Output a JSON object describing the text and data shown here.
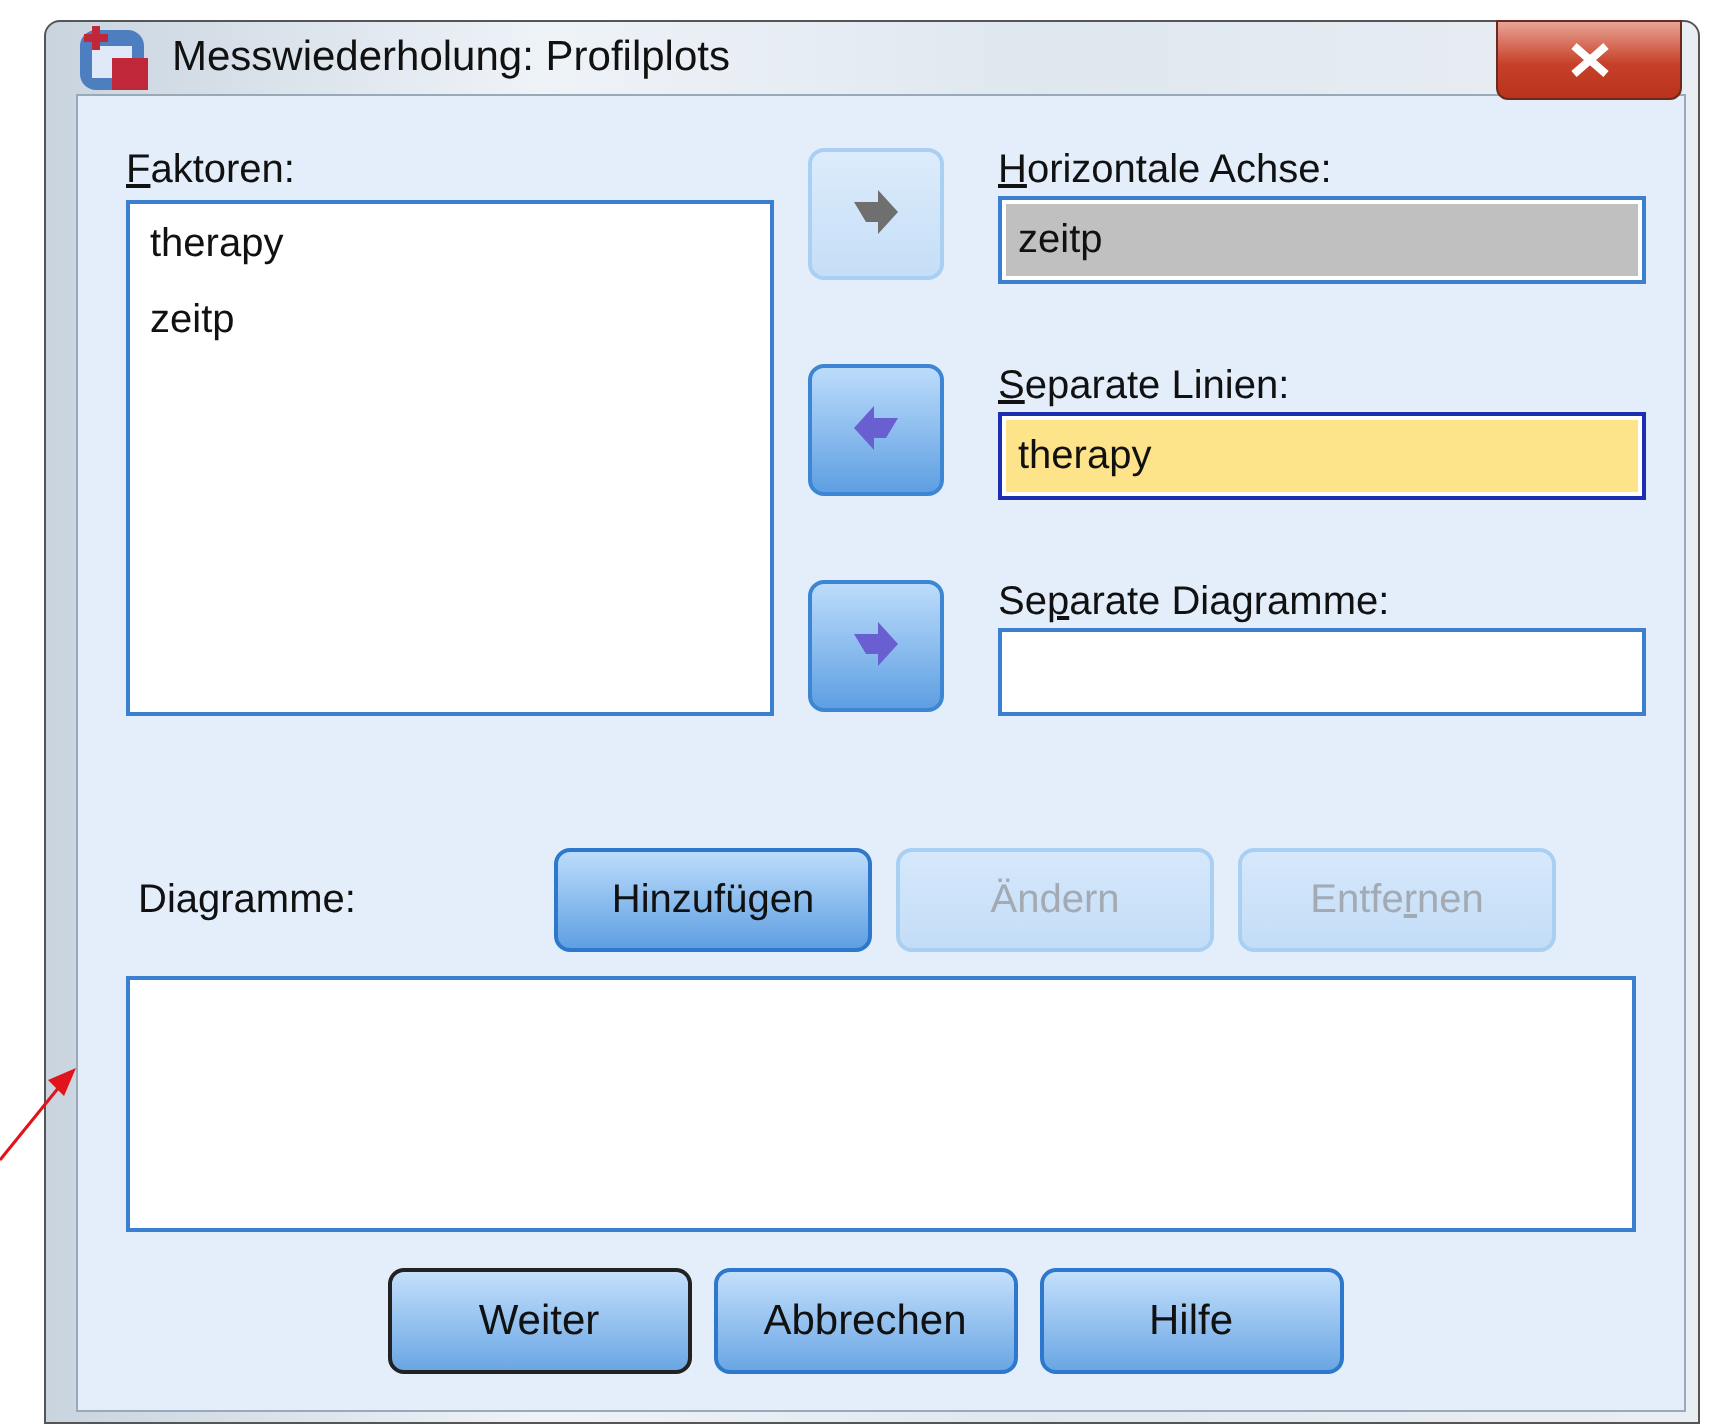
{
  "window": {
    "title": "Messwiederholung: Profilplots"
  },
  "factors": {
    "label": {
      "key": "F",
      "post": "aktoren:"
    },
    "items": [
      "therapy",
      "zeitp"
    ]
  },
  "targets": [
    {
      "label": {
        "key": "H",
        "post": "orizontale Achse:"
      },
      "value": "zeitp",
      "greyed": true,
      "focused": false,
      "arrow_left": false,
      "arrow_disabled": true
    },
    {
      "label": {
        "key": "S",
        "post": "eparate Linien:"
      },
      "value": "therapy",
      "greyed": false,
      "focused": true,
      "arrow_left": true,
      "arrow_disabled": false
    },
    {
      "label": {
        "pre": "Se",
        "key": "p",
        "post": "arate Diagramme:"
      },
      "greyed": false,
      "focused": false,
      "arrow_left": false,
      "arrow_disabled": false
    }
  ],
  "plots": {
    "label": "Diagramme:",
    "buttons": [
      {
        "pre": "Hinzufügen",
        "disabled": false
      },
      {
        "pre": "Ändern",
        "disabled": true
      },
      {
        "pre": "Entfe",
        "key": "r",
        "post": "nen",
        "disabled": true
      }
    ]
  },
  "buttons": [
    {
      "label": "Weiter",
      "default": true
    },
    {
      "label": "Abbrechen",
      "default": false
    },
    {
      "label": "Hilfe",
      "default": false
    }
  ]
}
